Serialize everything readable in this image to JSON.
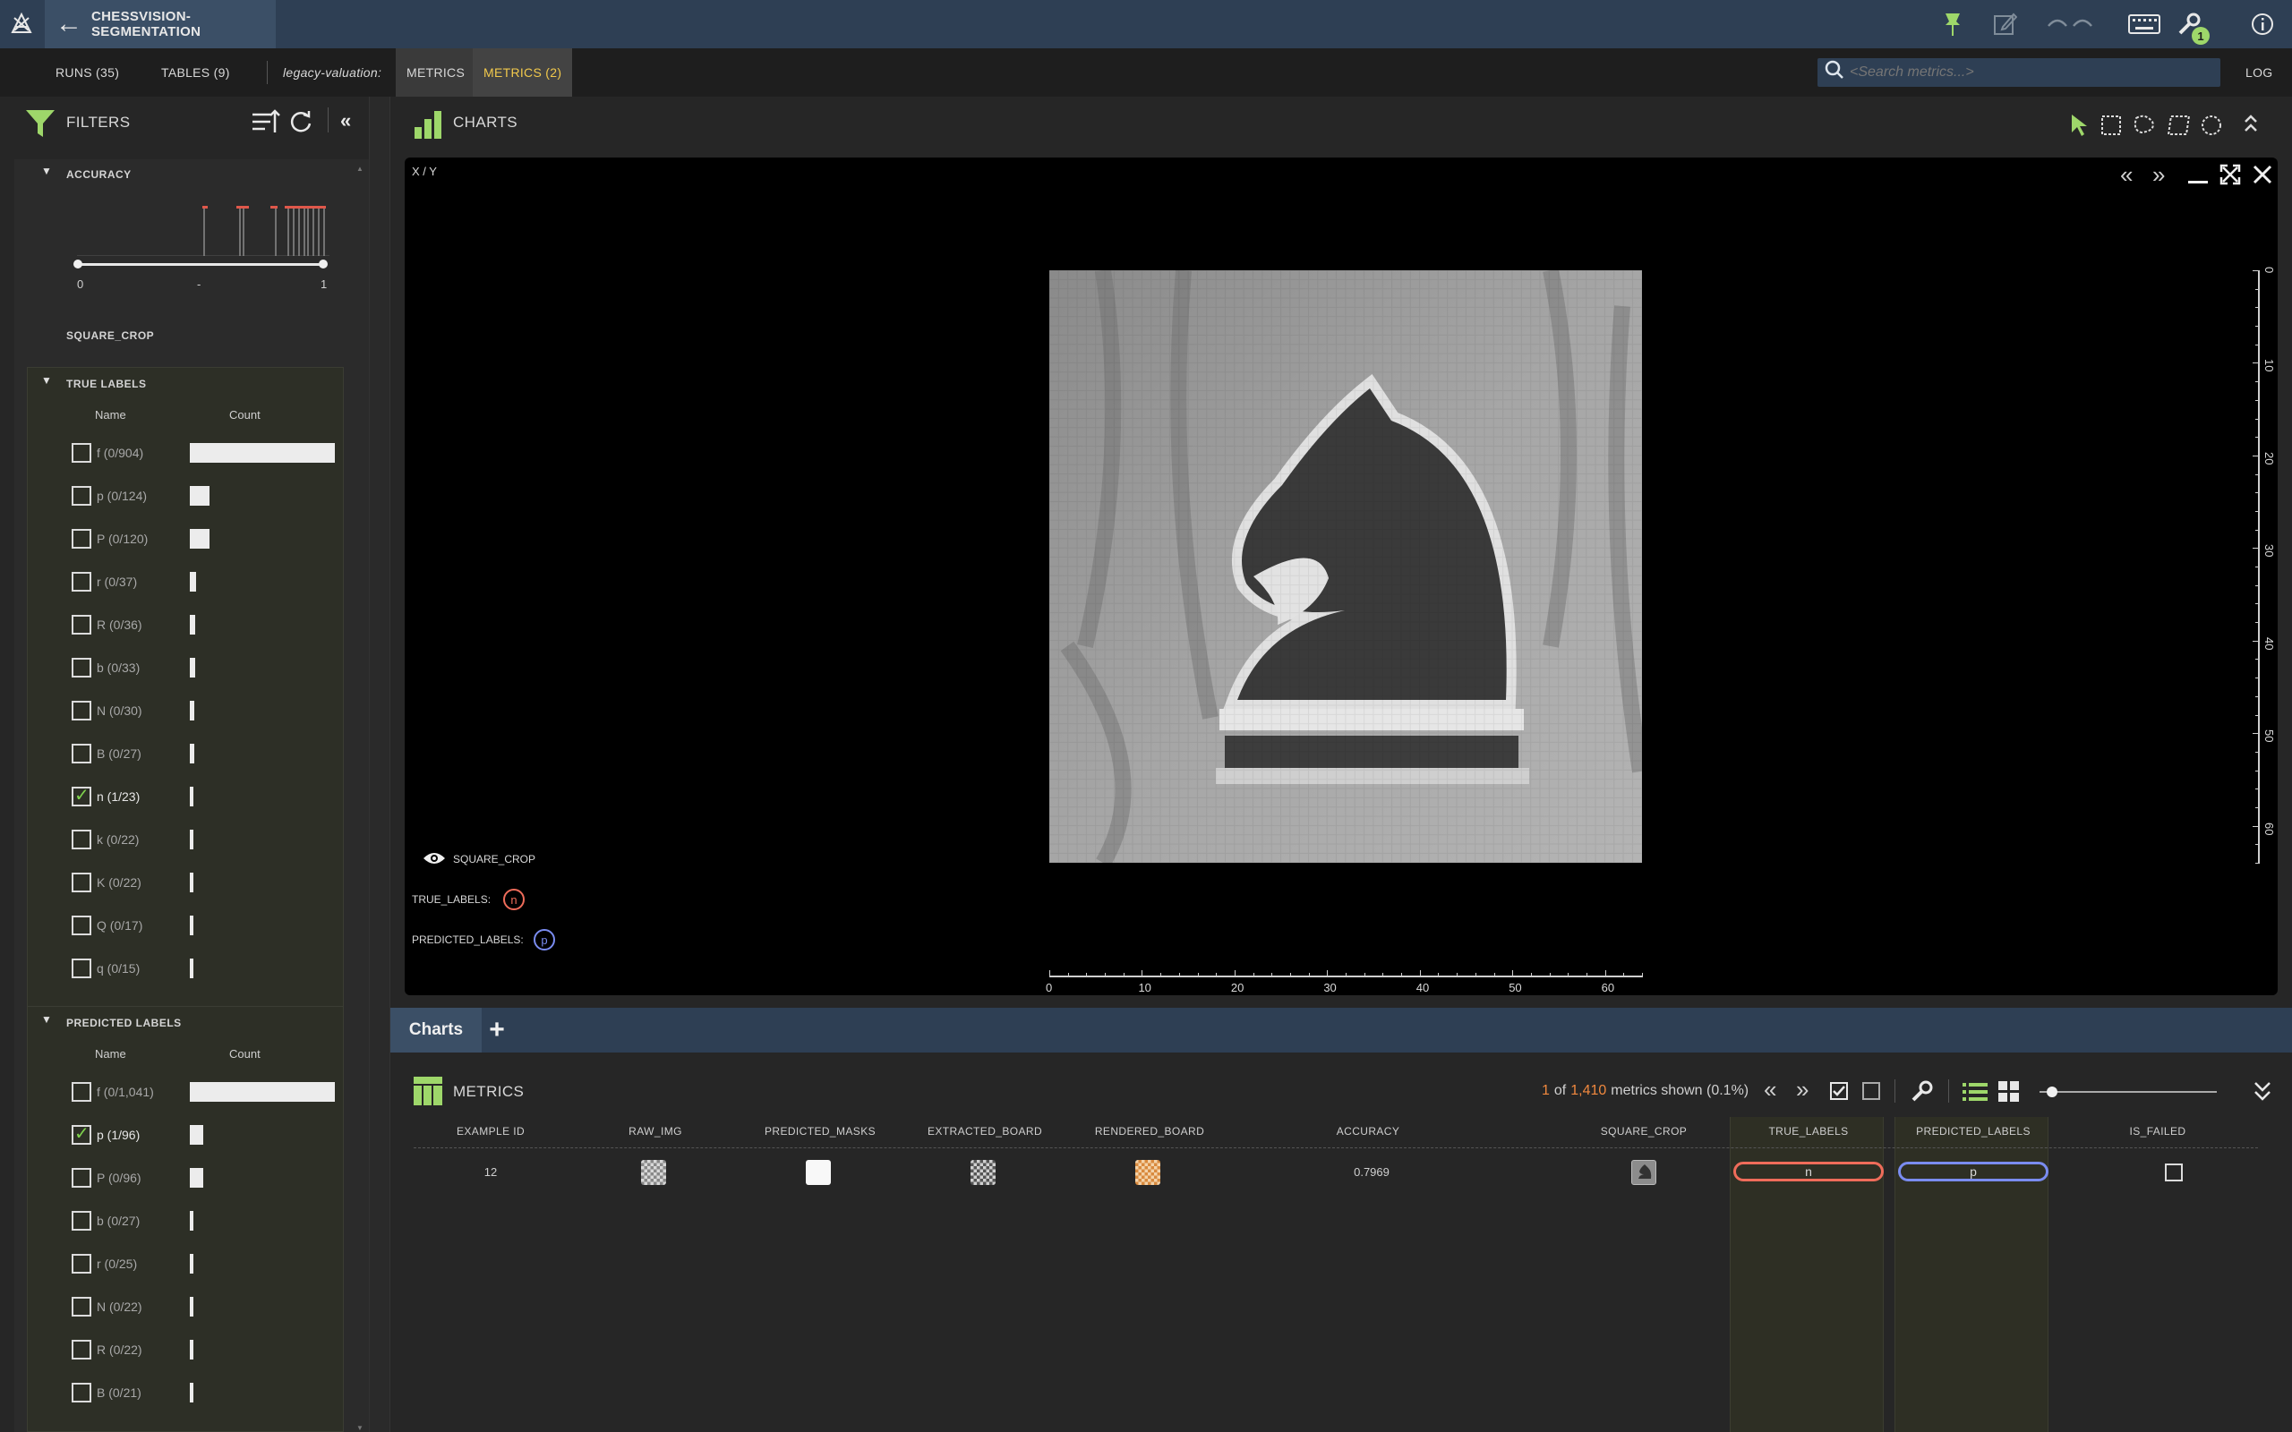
{
  "app": {
    "project_title": "CHESSVISION-SEGMENTATION",
    "notification_count": "1"
  },
  "subbar": {
    "runs": "RUNS (35)",
    "tables": "TABLES (9)",
    "view_name": "legacy-valuation:",
    "tab_metrics": "METRICS",
    "tab_metrics_active": "METRICS (2)",
    "search_placeholder": "<Search metrics...>",
    "log": "LOG"
  },
  "filters": {
    "title": "FILTERS",
    "accuracy": {
      "title": "ACCURACY",
      "min": "0",
      "mid": "-",
      "max": "1"
    },
    "square_crop": "SQUARE_CROP",
    "true_labels": {
      "title": "TRUE LABELS",
      "col_name": "Name",
      "col_count": "Count",
      "items": [
        {
          "label": "f (0/904)",
          "checked": false,
          "count": 904
        },
        {
          "label": "p (0/124)",
          "checked": false,
          "count": 124
        },
        {
          "label": "P (0/120)",
          "checked": false,
          "count": 120
        },
        {
          "label": "r (0/37)",
          "checked": false,
          "count": 37
        },
        {
          "label": "R (0/36)",
          "checked": false,
          "count": 36
        },
        {
          "label": "b (0/33)",
          "checked": false,
          "count": 33
        },
        {
          "label": "N (0/30)",
          "checked": false,
          "count": 30
        },
        {
          "label": "B (0/27)",
          "checked": false,
          "count": 27
        },
        {
          "label": "n (1/23)",
          "checked": true,
          "count": 23
        },
        {
          "label": "k (0/22)",
          "checked": false,
          "count": 22
        },
        {
          "label": "K (0/22)",
          "checked": false,
          "count": 22
        },
        {
          "label": "Q (0/17)",
          "checked": false,
          "count": 17
        },
        {
          "label": "q (0/15)",
          "checked": false,
          "count": 15
        }
      ]
    },
    "predicted_labels": {
      "title": "PREDICTED LABELS",
      "col_name": "Name",
      "col_count": "Count",
      "items": [
        {
          "label": "f (0/1,041)",
          "checked": false,
          "count": 1041
        },
        {
          "label": "p (1/96)",
          "checked": true,
          "count": 96
        },
        {
          "label": "P (0/96)",
          "checked": false,
          "count": 96
        },
        {
          "label": "b (0/27)",
          "checked": false,
          "count": 27
        },
        {
          "label": "r (0/25)",
          "checked": false,
          "count": 25
        },
        {
          "label": "N (0/22)",
          "checked": false,
          "count": 22
        },
        {
          "label": "R (0/22)",
          "checked": false,
          "count": 22
        },
        {
          "label": "B (0/21)",
          "checked": false,
          "count": 21
        }
      ]
    }
  },
  "charts": {
    "title": "CHARTS",
    "panel_title": "X / Y",
    "layer_name": "SQUARE_CROP",
    "true_labels_key": "TRUE_LABELS:",
    "true_labels_val": "n",
    "predicted_labels_key": "PREDICTED_LABELS:",
    "predicted_labels_val": "p",
    "x_ticks": [
      "0",
      "10",
      "20",
      "30",
      "40",
      "50",
      "60"
    ],
    "y_ticks": [
      "0",
      "10",
      "20",
      "30",
      "40",
      "50",
      "60"
    ],
    "tab_label": "Charts",
    "add_tab": "+"
  },
  "metrics": {
    "title": "METRICS",
    "shown_count": "1",
    "shown_of": "of",
    "shown_total": "1,410",
    "shown_suffix": "metrics shown (0.1%)",
    "columns": [
      "EXAMPLE ID",
      "RAW_IMG",
      "PREDICTED_MASKS",
      "EXTRACTED_BOARD",
      "RENDERED_BOARD",
      "ACCURACY",
      "SQUARE_CROP",
      "TRUE_LABELS",
      "PREDICTED_LABELS",
      "IS_FAILED"
    ],
    "row": {
      "example_id": "12",
      "accuracy": "0.7969",
      "true_label": "n",
      "predicted_label": "p",
      "is_failed": false
    }
  },
  "colors": {
    "accent": "#9ed76a",
    "highlight_text": "#f2c94c",
    "true_label": "#ef6c5a",
    "predicted_label": "#7a8cf0"
  }
}
